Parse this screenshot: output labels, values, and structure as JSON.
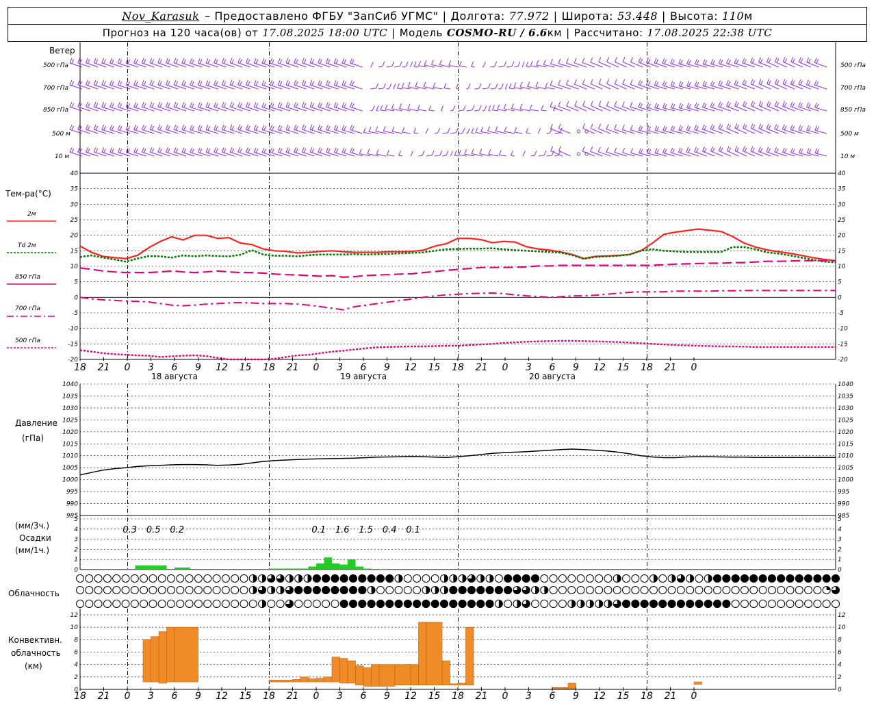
{
  "header": {
    "station": "Nov_Karasuk",
    "provider": "– Предоставлено ФГБУ \"ЗапСиб УГМС\"",
    "lon_label": "Долгота:",
    "lon": "77.972",
    "lat_label": "Широта:",
    "lat": "53.448",
    "alt_label": "Высота:",
    "alt": "110",
    "alt_unit": "м",
    "forecast_label": "Прогноз на 120 часа(ов) от",
    "forecast_from": "17.08.2025 18:00 UTC",
    "model_label": "Модель",
    "model": "COSMO-RU / 6.6",
    "model_unit": "км",
    "calc_label": "Рассчитано:",
    "calc_time": "17.08.2025 22:38 UTC"
  },
  "labels": {
    "wind_title": "Ветер",
    "wind_levels": [
      "500 гПа",
      "700 гПа",
      "850 гПа",
      "500 м",
      "10  м"
    ],
    "temp_title": "Тем-ра(°C)",
    "temp_legend": [
      "2м",
      "Td  2м",
      "850 гПа",
      "700 гПа",
      "500 гПа"
    ],
    "pressure_title": "Давление",
    "pressure_unit": "(гПа)",
    "precip_unit_3h": "(мм/3ч.)",
    "precip_title": "Осадки",
    "precip_unit_1h": "(мм/1ч.)",
    "cloud_title": "Облачность",
    "conv_title": [
      "Конвективн.",
      "облачность",
      "(км)"
    ]
  },
  "colors": {
    "wind": "#8a2be2",
    "t2m": "#ff2020",
    "td2m": "#007a00",
    "t850": "#e0007a",
    "t700": "#e0007a",
    "t500": "#e0007a",
    "pressure": "#000000",
    "precip": "#22cc22",
    "conv": "#f08c28"
  },
  "chart_data": [
    {
      "type": "line",
      "title": "Тем-ра(°C)",
      "x_hours": [
        18,
        21,
        0,
        3,
        6,
        9,
        12,
        15,
        18,
        21,
        0,
        3,
        6,
        9,
        12,
        15,
        18,
        21,
        0,
        3,
        6,
        9,
        12,
        15,
        18,
        21,
        0
      ],
      "date_labels": [
        "18 августа",
        "19 августа",
        "20 августа"
      ],
      "ylim": [
        -20,
        40
      ],
      "yticks": [
        40,
        35,
        30,
        25,
        20,
        15,
        10,
        5,
        0,
        -5,
        -10,
        -15,
        -20
      ],
      "series": [
        {
          "name": "2м",
          "key": "t2m",
          "values": [
            16.5,
            14.5,
            13.2,
            12.8,
            12.5,
            13.5,
            16,
            18,
            19.5,
            18.5,
            20,
            20,
            19,
            19.2,
            17.5,
            17,
            15.6,
            15,
            14.8,
            14.3,
            14.5,
            14.8,
            15,
            14.7,
            14.5,
            14.5,
            14.5,
            14.7,
            14.7,
            14.8,
            15.2,
            16.5,
            17.3,
            19,
            19,
            18.6,
            17.6,
            18,
            17.8,
            16.3,
            15.6,
            15.2,
            14.6,
            13.8,
            12.5,
            13.2,
            13.3,
            13.5,
            13.8,
            15,
            17.5,
            20.3,
            21,
            21.5,
            22,
            21.6,
            21.2,
            19.6,
            17.5,
            16.2,
            15.3,
            14.7,
            14.2,
            13.5,
            12.8,
            12.2,
            11.8
          ]
        },
        {
          "name": "Td  2м",
          "key": "td2m",
          "values": [
            13,
            13.5,
            12.8,
            12.2,
            11.5,
            12.5,
            13.3,
            13.2,
            12.8,
            13.5,
            13.2,
            13.5,
            13.3,
            13.2,
            13.7,
            15.2,
            13.8,
            13.4,
            13.4,
            13.2,
            13.6,
            13.8,
            13.8,
            13.8,
            13.9,
            13.8,
            13.9,
            14,
            14.2,
            14.3,
            14.5,
            15,
            15.5,
            15.6,
            15.7,
            15.7,
            15.8,
            15.5,
            15.2,
            15,
            14.8,
            14.6,
            14.4,
            13.6,
            12.4,
            13,
            13.2,
            13.4,
            13.8,
            15,
            15.5,
            15,
            14.8,
            14.6,
            14.6,
            14.6,
            14.6,
            16.2,
            16.2,
            15.5,
            14.5,
            14.1,
            13.5,
            12.8,
            12.1,
            11.5,
            11.3
          ]
        },
        {
          "name": "850 гПа",
          "key": "t850",
          "values": [
            9.5,
            9,
            8.5,
            8.2,
            8,
            8,
            8,
            8.2,
            8.5,
            8.2,
            8,
            8.2,
            8.5,
            8.2,
            8,
            8,
            7.8,
            7.5,
            7.3,
            7.2,
            7,
            6.8,
            7,
            6.5,
            6.7,
            7,
            7.2,
            7.3,
            7.5,
            7.6,
            8,
            8.3,
            8.7,
            9,
            9.3,
            9.6,
            9.6,
            9.6,
            9.7,
            9.8,
            10.1,
            10.1,
            10.3,
            10.3,
            10.3,
            10.3,
            10.3,
            10.3,
            10.3,
            10.3,
            10.3,
            10.5,
            10.7,
            10.8,
            10.9,
            11,
            11,
            11.2,
            11.2,
            11.4,
            11.6,
            11.6,
            11.7,
            11.8,
            11.8,
            11.8,
            11.8
          ]
        },
        {
          "name": "700 гПа",
          "key": "t700",
          "values": [
            0,
            -0.5,
            -0.8,
            -1,
            -1.2,
            -1.3,
            -1.5,
            -2,
            -2.5,
            -2.7,
            -2.5,
            -2.2,
            -2,
            -1.8,
            -1.7,
            -1.8,
            -2,
            -2,
            -2,
            -2.2,
            -2.5,
            -3,
            -3.5,
            -4,
            -3,
            -2.5,
            -2,
            -1.5,
            -1,
            -0.5,
            0,
            0.5,
            0.8,
            1,
            1.2,
            1.3,
            1.4,
            1.2,
            0.8,
            0.5,
            0.3,
            0,
            0.2,
            0.5,
            0.5,
            0.7,
            1,
            1.3,
            1.6,
            1.8,
            1.8,
            1.8,
            2,
            2,
            2,
            2,
            2.1,
            2.1,
            2.2,
            2.2,
            2.2,
            2.2,
            2.2,
            2.2,
            2.2,
            2.2,
            2.2
          ]
        },
        {
          "name": "500 гПа",
          "key": "t500",
          "values": [
            -17,
            -17.5,
            -18,
            -18.3,
            -18.5,
            -18.7,
            -18.8,
            -19.2,
            -19,
            -18.8,
            -18.7,
            -18.9,
            -19.5,
            -20,
            -20.5,
            -21,
            -20.5,
            -19.8,
            -19.2,
            -18.7,
            -18.5,
            -18,
            -17.5,
            -17.2,
            -16.8,
            -16.4,
            -16.1,
            -16,
            -15.9,
            -15.8,
            -15.8,
            -15.7,
            -15.6,
            -15.6,
            -15.4,
            -15.2,
            -15,
            -14.7,
            -14.5,
            -14.3,
            -14.2,
            -14.1,
            -14,
            -14,
            -14.1,
            -14.2,
            -14.3,
            -14.4,
            -14.6,
            -14.8,
            -15,
            -15.2,
            -15.4,
            -15.5,
            -15.6,
            -15.7,
            -15.8,
            -15.8,
            -15.9,
            -16,
            -16,
            -16,
            -16,
            -16,
            -16,
            -16,
            -16
          ]
        }
      ]
    },
    {
      "type": "line",
      "title": "Давление (гПа)",
      "ylim": [
        985,
        1040
      ],
      "yticks": [
        1040,
        1035,
        1030,
        1025,
        1020,
        1015,
        1010,
        1005,
        1000,
        995,
        990,
        985
      ],
      "series": [
        {
          "name": "Давление",
          "key": "pressure",
          "values": [
            1002,
            1003,
            1004,
            1004.6,
            1005,
            1005.5,
            1005.8,
            1006,
            1006.2,
            1006.3,
            1006.3,
            1006.2,
            1006,
            1006.1,
            1006.4,
            1007,
            1007.6,
            1008,
            1008.2,
            1008.4,
            1008.6,
            1008.7,
            1008.8,
            1008.9,
            1009,
            1009.2,
            1009.4,
            1009.5,
            1009.6,
            1009.7,
            1009.6,
            1009.4,
            1009.3,
            1009.6,
            1010,
            1010.5,
            1011,
            1011.3,
            1011.5,
            1011.7,
            1012,
            1012.3,
            1012.6,
            1012.8,
            1012.6,
            1012.3,
            1012,
            1011.5,
            1010.8,
            1010,
            1009.5,
            1009.2,
            1009.2,
            1009.5,
            1009.6,
            1009.6,
            1009.5,
            1009.4,
            1009.4,
            1009.3,
            1009.3,
            1009.3,
            1009.3,
            1009.3,
            1009.3,
            1009.3,
            1009.3
          ]
        }
      ]
    },
    {
      "type": "bar",
      "title": "Осадки",
      "ylim": [
        0,
        5
      ],
      "yticks": [
        5,
        4,
        3,
        2,
        1,
        0
      ],
      "sums_3h": [
        {
          "hour_index": 6.5,
          "value": "0.3"
        },
        {
          "hour_index": 9.5,
          "value": "0.5"
        },
        {
          "hour_index": 12.5,
          "value": "0.2"
        },
        {
          "hour_index": 30.5,
          "value": "0.1"
        },
        {
          "hour_index": 33.5,
          "value": "1.6"
        },
        {
          "hour_index": 36.5,
          "value": "1.5"
        },
        {
          "hour_index": 39.5,
          "value": "0.4"
        },
        {
          "hour_index": 42.5,
          "value": "0.1"
        }
      ],
      "bars_1h": [
        {
          "from": 7,
          "to": 11,
          "value": 0.4
        },
        {
          "from": 12,
          "to": 14,
          "value": 0.2
        },
        {
          "from": 24,
          "to": 27,
          "value": 0.1
        },
        {
          "from": 27,
          "to": 29,
          "value": 0.1
        },
        {
          "from": 29,
          "to": 30,
          "value": 0.3
        },
        {
          "from": 30,
          "to": 31,
          "value": 0.6
        },
        {
          "from": 31,
          "to": 32,
          "value": 1.2
        },
        {
          "from": 32,
          "to": 33,
          "value": 0.6
        },
        {
          "from": 33,
          "to": 34,
          "value": 0.5
        },
        {
          "from": 34,
          "to": 35,
          "value": 1.0
        },
        {
          "from": 35,
          "to": 36,
          "value": 0.3
        },
        {
          "from": 36,
          "to": 37,
          "value": 0.1
        },
        {
          "from": 38,
          "to": 39,
          "value": 0.05
        }
      ]
    },
    {
      "type": "table",
      "title": "Облачность",
      "rows_note": "octas of cloud cover per hour, 3 rows (upper, middle, lower)",
      "rows": [
        [
          0,
          0,
          0,
          0,
          0,
          0,
          0,
          0,
          0,
          0,
          0,
          0,
          0,
          0,
          0,
          0,
          0,
          0,
          0,
          4,
          4,
          6,
          6,
          4,
          4,
          4,
          8,
          8,
          8,
          8,
          8,
          8,
          8,
          8,
          8,
          4,
          0,
          0,
          0,
          0,
          4,
          4,
          4,
          6,
          4,
          4,
          0,
          8,
          8,
          8,
          8,
          0,
          0,
          0,
          0,
          0,
          0,
          0,
          0,
          4,
          0,
          0,
          0,
          4,
          0,
          4,
          6,
          4,
          0,
          4,
          8,
          8,
          8,
          8,
          8,
          8,
          8,
          8,
          8,
          8,
          8,
          8,
          8,
          8
        ],
        [
          0,
          0,
          0,
          0,
          0,
          0,
          0,
          0,
          0,
          0,
          0,
          0,
          0,
          0,
          0,
          0,
          0,
          0,
          0,
          4,
          6,
          4,
          4,
          6,
          8,
          8,
          8,
          8,
          8,
          8,
          8,
          8,
          4,
          0,
          0,
          0,
          0,
          0,
          4,
          4,
          4,
          8,
          8,
          8,
          8,
          8,
          8,
          8,
          6,
          6,
          4,
          4,
          0,
          0,
          0,
          0,
          0,
          0,
          0,
          0,
          0,
          0,
          0,
          0,
          0,
          0,
          0,
          0,
          0,
          0,
          0,
          0,
          0,
          0,
          0,
          0,
          0,
          0,
          0,
          0,
          0,
          0,
          2,
          6
        ],
        [
          0,
          0,
          0,
          0,
          0,
          0,
          0,
          0,
          0,
          0,
          0,
          0,
          0,
          0,
          0,
          0,
          0,
          0,
          0,
          0,
          4,
          0,
          0,
          6,
          0,
          0,
          0,
          0,
          0,
          8,
          8,
          8,
          8,
          8,
          8,
          8,
          8,
          8,
          8,
          8,
          8,
          8,
          8,
          8,
          8,
          8,
          4,
          0,
          4,
          6,
          0,
          0,
          0,
          0,
          4,
          4,
          4,
          4,
          4,
          6,
          8,
          8,
          8,
          8,
          8,
          8,
          8,
          8,
          8,
          8,
          8,
          8,
          0,
          0,
          0,
          0,
          0,
          0,
          0,
          0,
          0,
          0,
          0,
          0
        ]
      ]
    },
    {
      "type": "bar",
      "title": "Конвективн. облачность (км)",
      "ylim": [
        0,
        13
      ],
      "yticks": [
        12,
        10,
        8,
        6,
        4,
        2,
        0
      ],
      "bars": [
        {
          "from": 8,
          "to": 9,
          "base": 1.2,
          "top": 8.0
        },
        {
          "from": 9,
          "to": 10,
          "base": 1.2,
          "top": 8.5
        },
        {
          "from": 10,
          "to": 11,
          "base": 1.0,
          "top": 9.3
        },
        {
          "from": 11,
          "to": 12,
          "base": 1.2,
          "top": 10.0
        },
        {
          "from": 12,
          "to": 15,
          "base": 1.2,
          "top": 10.0
        },
        {
          "from": 24,
          "to": 27,
          "base": 1.2,
          "top": 1.5
        },
        {
          "from": 27,
          "to": 28,
          "base": 1.2,
          "top": 1.6
        },
        {
          "from": 28,
          "to": 29,
          "base": 1.2,
          "top": 2.0
        },
        {
          "from": 29,
          "to": 30,
          "base": 1.2,
          "top": 1.7
        },
        {
          "from": 30,
          "to": 31,
          "base": 1.2,
          "top": 1.8
        },
        {
          "from": 31,
          "to": 32,
          "base": 1.2,
          "top": 2.0
        },
        {
          "from": 32,
          "to": 33,
          "base": 1.2,
          "top": 5.2
        },
        {
          "from": 33,
          "to": 34,
          "base": 1.0,
          "top": 5.0
        },
        {
          "from": 34,
          "to": 35,
          "base": 1.0,
          "top": 4.6
        },
        {
          "from": 35,
          "to": 36,
          "base": 0.7,
          "top": 3.8
        },
        {
          "from": 36,
          "to": 37,
          "base": 0.5,
          "top": 3.5
        },
        {
          "from": 37,
          "to": 38,
          "base": 0.5,
          "top": 4.0
        },
        {
          "from": 38,
          "to": 40,
          "base": 0.5,
          "top": 4.0
        },
        {
          "from": 40,
          "to": 42,
          "base": 0.7,
          "top": 4.0
        },
        {
          "from": 42,
          "to": 43,
          "base": 0.7,
          "top": 4.0
        },
        {
          "from": 43,
          "to": 44,
          "base": 0.7,
          "top": 10.8
        },
        {
          "from": 44,
          "to": 46,
          "base": 0.7,
          "top": 10.8
        },
        {
          "from": 46,
          "to": 47,
          "base": 0.7,
          "top": 4.6
        },
        {
          "from": 47,
          "to": 48,
          "base": 0.7,
          "top": 0.9
        },
        {
          "from": 48,
          "to": 49,
          "base": 0.7,
          "top": 1.0
        },
        {
          "from": 49,
          "to": 50,
          "base": 0.7,
          "top": 10.0
        },
        {
          "from": 60,
          "to": 62,
          "base": 0.1,
          "top": 0.3
        },
        {
          "from": 62,
          "to": 63,
          "base": 0.1,
          "top": 1.0
        },
        {
          "from": 78,
          "to": 79,
          "base": 0.8,
          "top": 1.2
        }
      ]
    }
  ]
}
